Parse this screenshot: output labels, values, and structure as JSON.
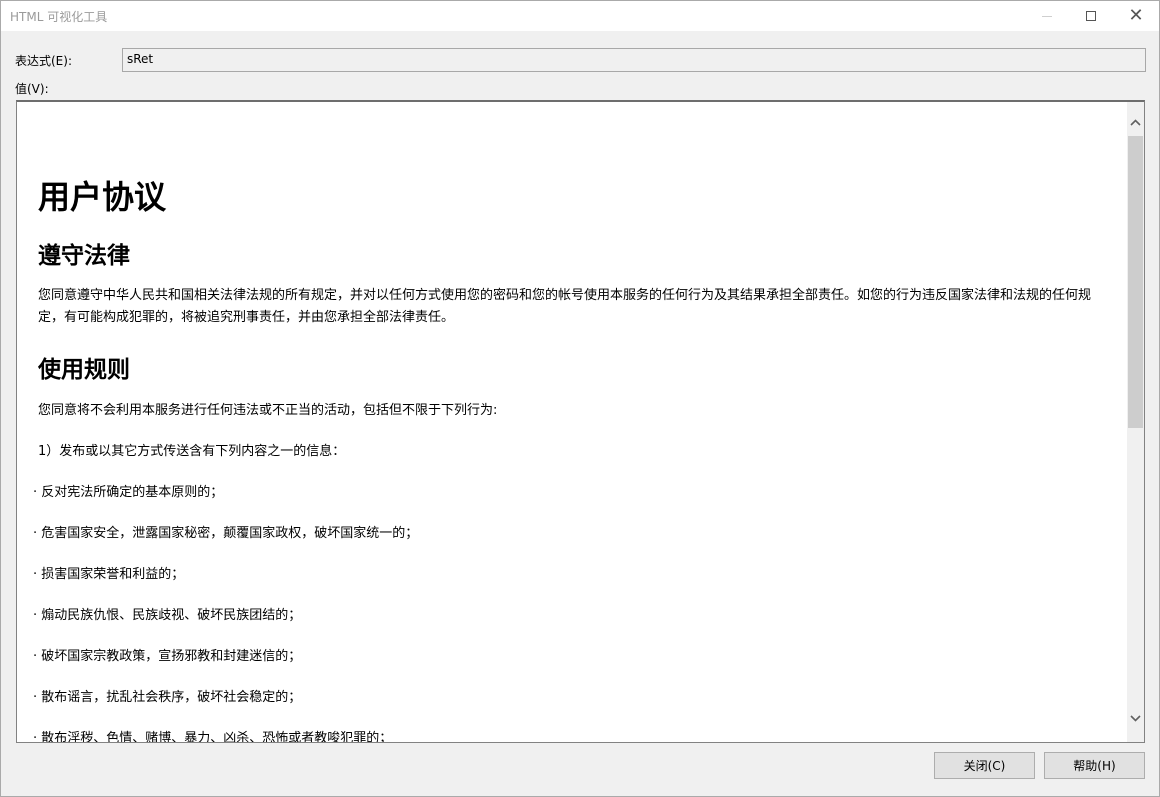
{
  "window": {
    "title": "HTML 可视化工具"
  },
  "form": {
    "expr_label": "表达式(E):",
    "expr_value": "sRet",
    "value_label": "值(V):"
  },
  "doc": {
    "title": "用户协议",
    "section1_heading": "遵守法律",
    "section1_text": "您同意遵守中华人民共和国相关法律法规的所有规定，并对以任何方式使用您的密码和您的帐号使用本服务的任何行为及其结果承担全部责任。如您的行为违反国家法律和法规的任何规定，有可能构成犯罪的，将被追究刑事责任，并由您承担全部法律责任。",
    "section2_heading": "使用规则",
    "section2_intro": "您同意将不会利用本服务进行任何违法或不正当的活动，包括但不限于下列行为:",
    "list_intro": "1）发布或以其它方式传送含有下列内容之一的信息：",
    "items": [
      "· 反对宪法所确定的基本原则的；",
      "· 危害国家安全，泄露国家秘密，颠覆国家政权，破坏国家统一的；",
      "· 损害国家荣誉和利益的；",
      "· 煽动民族仇恨、民族歧视、破坏民族团结的；",
      "· 破坏国家宗教政策，宣扬邪教和封建迷信的；",
      "· 散布谣言，扰乱社会秩序，破坏社会稳定的；",
      "· 散布淫秽、色情、赌博、暴力、凶杀、恐怖或者教唆犯罪的；"
    ]
  },
  "buttons": {
    "close_label": "关闭(C)",
    "help_label": "帮助(H)"
  }
}
